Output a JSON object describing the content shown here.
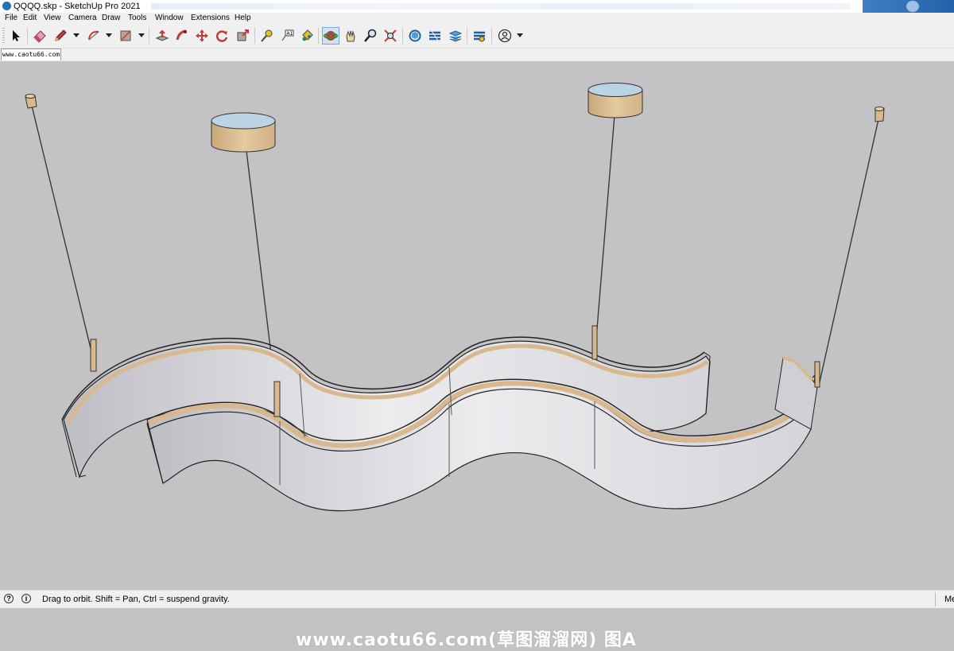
{
  "window": {
    "title": "QQQQ.skp - SketchUp Pro 2021"
  },
  "menu": [
    "File",
    "Edit",
    "View",
    "Camera",
    "Draw",
    "Tools",
    "Window",
    "Extensions",
    "Help"
  ],
  "toolbar": {
    "tools": [
      "select-icon",
      "eraser-icon",
      "pencil-icon",
      "arc-icon",
      "rectangle-icon",
      "push-pull-icon",
      "follow-me-icon",
      "move-icon",
      "rotate-icon",
      "scale-icon",
      "tape-measure-icon",
      "text-icon",
      "paint-bucket-icon",
      "orbit-icon",
      "pan-icon",
      "zoom-icon",
      "zoom-extents-icon",
      "3d-warehouse-icon",
      "extension-warehouse-icon",
      "layout-icon",
      "extension-manager-icon",
      "account-icon"
    ],
    "active_tool": "orbit-icon"
  },
  "scene_tab": {
    "label": "www.caotu66.com"
  },
  "viewport": {
    "background": "#c3c3c6",
    "watermark": "www.caotu66.com(草图溜溜网) 图A"
  },
  "status": {
    "message": "Drag to orbit. Shift = Pan, Ctrl = suspend gravity.",
    "measurements_label": "Me"
  },
  "colors": {
    "wood": "#d8b88c",
    "wall": "#d9d9de",
    "accent": "#2a6fb5"
  }
}
